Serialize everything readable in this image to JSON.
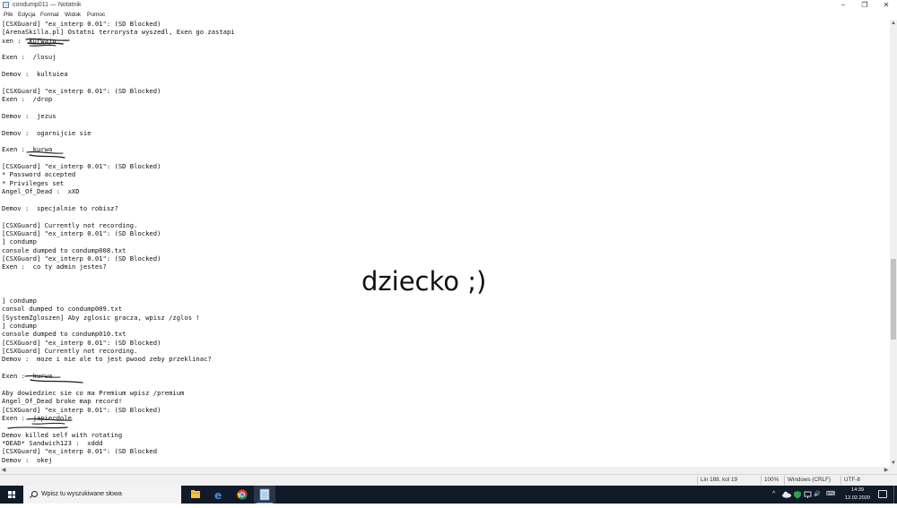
{
  "window": {
    "title": "condump011 — Notatnik",
    "controls": {
      "minimize": "−",
      "maximize": "❐",
      "close": "✕"
    }
  },
  "menu": [
    "Plik",
    "Edycja",
    "Format",
    "Widok",
    "Pomoc"
  ],
  "editor": {
    "lines": [
      "[CSXGuard] \"ex_interp 0.01\": (SD Blocked)",
      "[ArenaSkilla.pl] Ostatni terrorysta wyszedl, Exen go zastapi",
      "xen :  kurwaju",
      "",
      "Exen :  /losuj",
      "",
      "Demov :  kultuiea",
      "",
      "[CSXGuard] \"ex_interp 0.01\": (SD Blocked)",
      "Exen :  /drop",
      "",
      "Demov :  jezus",
      "",
      "Demov :  ogarnijcie sie",
      "",
      "Exen :  kurwa",
      "",
      "[CSXGuard] \"ex_interp 0.01\": (SD Blocked)",
      "* Password accepted",
      "* Privileges set",
      "Angel_Of_Dead :  xXD",
      "",
      "Demov :  specjalnie to robisz?",
      "",
      "[CSXGuard] Currently not recording.",
      "[CSXGuard] \"ex_interp 0.01\": (SD Blocked)",
      "] condump",
      "console dumped to condump008.txt",
      "[CSXGuard] \"ex_interp 0.01\": (SD Blocked)",
      "Exen :  co ty admin jestes?",
      "",
      "",
      "",
      "] condump",
      "consol dumped to condump009.txt",
      "[SystemZgloszen] Aby zglosic gracza, wpisz /zglos !",
      "] condump",
      "console dumped to condump010.txt",
      "[CSXGuard] \"ex_interp 0.01\": (SD Blocked)",
      "[CSXGuard] Currently not recording.",
      "Demov :  moze i nie ale to jest pwood zeby przeklinac?",
      "",
      "Exen :  kurwa",
      "",
      "Aby dowiedziec sie co ma Premium wpisz /premium",
      "Angel_Of_Dead broke map record!",
      "[CSXGuard] \"ex_interp 0.01\": (SD Blocked)",
      "Exen :  japierdole",
      "",
      "Demov killed self with rotating",
      "*DEAD* Sandwich123 :  xddd",
      "[CSXGuard] \"ex_interp 0.01\": (SD Blocked",
      "Demov :  okej"
    ],
    "overlay_text": "dziecko ;)"
  },
  "scrollbars": {
    "up": "▲",
    "down": "▼",
    "left": "◀",
    "right": "▶"
  },
  "status": {
    "position": "Lin 188, kol 19",
    "zoom": "100%",
    "line_ending": "Windows (CRLF)",
    "encoding": "UTF-8"
  },
  "taskbar": {
    "search_placeholder": "Wpisz tu wyszukiwane słowa",
    "apps": [
      "file-explorer-icon",
      "edge-icon",
      "chrome-icon",
      "notepad-icon"
    ],
    "tray": {
      "chevron": "^",
      "volume": "🔊",
      "keyboard": "⌨"
    },
    "time": "14:39",
    "date": "12.02.2020"
  },
  "colors": {
    "taskbar": "#101a28",
    "accent": "#7fb3e8",
    "scribble": "#1a1a1a"
  }
}
